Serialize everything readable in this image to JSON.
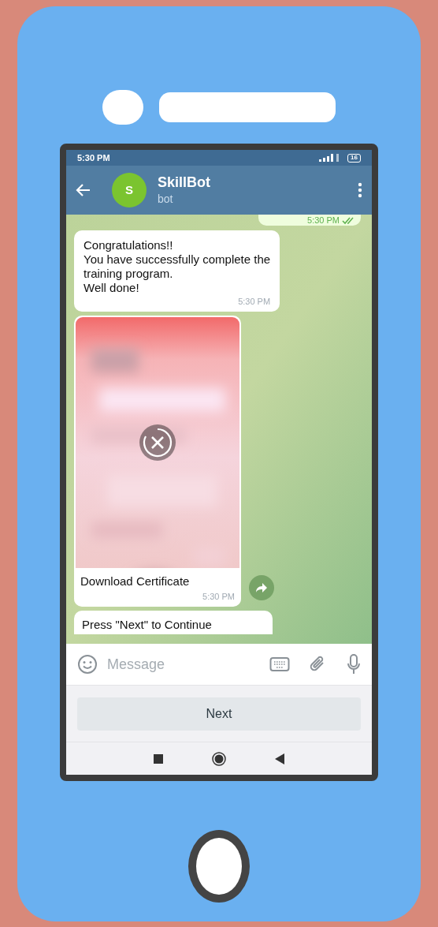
{
  "status_bar": {
    "time": "5:30 PM",
    "battery": "16"
  },
  "chat_header": {
    "avatar_letter": "S",
    "title": "SkillBot",
    "subtitle": "bot"
  },
  "messages": [
    {
      "kind": "outgoing_partial",
      "time": "5:30 PM"
    },
    {
      "kind": "text",
      "text": "Congratulations!!\nYou have successfully complete the\ntraining program.\nWell done!",
      "time": "5:30 PM"
    },
    {
      "caption": "Download Certificate",
      "time": "5:30 PM"
    },
    {
      "kind": "text_cut",
      "text": "Press \"Next\" to Continue"
    }
  ],
  "composer": {
    "placeholder": "Message"
  },
  "bot_keyboard": [
    "Next"
  ]
}
